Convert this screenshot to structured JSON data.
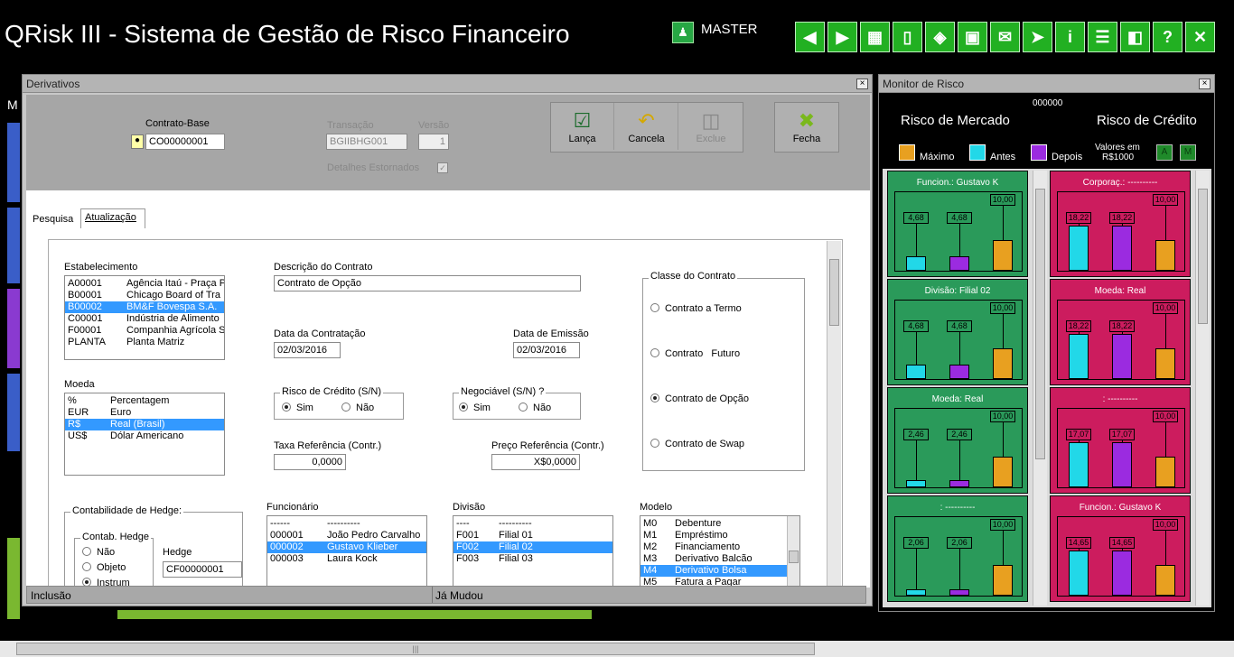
{
  "app": {
    "title": "QRisk III - Sistema de Gestão de Risco Financeiro",
    "user": "MASTER",
    "left_letter": "M"
  },
  "toolbar": {
    "icons": [
      "arrow-left-icon",
      "arrow-right-icon",
      "traffic-light-icon",
      "list-icon",
      "paint-bucket-icon",
      "monitor-icon",
      "email-icon",
      "forward-icon",
      "info-icon",
      "help-document-icon",
      "exit-door-icon",
      "question-icon",
      "close-icon"
    ]
  },
  "derivativos": {
    "title": "Derivativos",
    "close": "×",
    "contrato_base": {
      "label": "Contrato-Base",
      "value": "CO00000001"
    },
    "transacao": {
      "label": "Transação",
      "value": "BGIIBHG001"
    },
    "versao": {
      "label": "Versão",
      "value": "1"
    },
    "detalhes": {
      "label": "Detalhes Estornados"
    },
    "buttons": {
      "lanca": "Lança",
      "cancela": "Cancela",
      "exclue": "Exclue",
      "fecha": "Fecha"
    },
    "tabs": [
      "Pesquisa",
      "Atualização"
    ],
    "estabelecimento": {
      "label": "Estabelecimento",
      "rows": [
        [
          "A00001",
          "Agência Itaú - Praça P"
        ],
        [
          "B00001",
          "Chicago Board of Tra"
        ],
        [
          "B00002",
          "BM&F Bovespa S.A."
        ],
        [
          "C00001",
          "Indústria de Alimento"
        ],
        [
          "F00001",
          "Companhia Agrícola S"
        ],
        [
          "PLANTA",
          "Planta Matriz"
        ]
      ]
    },
    "moeda": {
      "label": "Moeda",
      "rows": [
        [
          "%",
          "Percentagem"
        ],
        [
          "EUR",
          "Euro"
        ],
        [
          "R$",
          "Real (Brasil)"
        ],
        [
          "US$",
          "Dólar Americano"
        ]
      ]
    },
    "descricao": {
      "label": "Descrição do Contrato",
      "value": "Contrato de Opção"
    },
    "data_contratacao": {
      "label": "Data da Contratação",
      "value": "02/03/2016"
    },
    "data_emissao": {
      "label": "Data de Emissão",
      "value": "02/03/2016"
    },
    "risco_credito": {
      "label": "Risco de Crédito (S/N)",
      "sim": "Sim",
      "nao": "Não"
    },
    "negociavel": {
      "label": "Negociável (S/N) ?",
      "sim": "Sim",
      "nao": "Não"
    },
    "taxa": {
      "label": "Taxa Referência (Contr.)",
      "value": "0,0000"
    },
    "preco": {
      "label": "Preço Referência (Contr.)",
      "value": "X$0,0000"
    },
    "classe": {
      "label": "Classe do Contrato",
      "options": [
        "Contrato a Termo",
        "Contrato   Futuro",
        "Contrato de Opção",
        "Contrato de Swap"
      ]
    },
    "hedge": {
      "group": "Contabilidade de Hedge:",
      "sub": "Contab. Hedge",
      "nao": "Não",
      "objeto": "Objeto",
      "instrum": "Instrum",
      "hedge_label": "Hedge",
      "hedge_value": "CF00000001"
    },
    "funcionario": {
      "label": "Funcionário",
      "rows": [
        [
          "------",
          "----------"
        ],
        [
          "000001",
          "João Pedro Carvalho"
        ],
        [
          "000002",
          "Gustavo Klieber"
        ],
        [
          "000003",
          "Laura Kock"
        ]
      ]
    },
    "divisao": {
      "label": "Divisão",
      "rows": [
        [
          "----",
          "----------"
        ],
        [
          "F001",
          "Filial 01"
        ],
        [
          "F002",
          "Filial 02"
        ],
        [
          "F003",
          "Filial 03"
        ]
      ]
    },
    "modelo": {
      "label": "Modelo",
      "rows": [
        [
          "M0",
          "Debenture"
        ],
        [
          "M1",
          "Empréstimo"
        ],
        [
          "M2",
          "Financiamento"
        ],
        [
          "M3",
          "Derivativo Balcão"
        ],
        [
          "M4",
          "Derivativo Bolsa"
        ],
        [
          "M5",
          "Fatura a Pagar"
        ]
      ]
    },
    "status": {
      "left": "Inclusão",
      "right": "Já Mudou"
    }
  },
  "monitor": {
    "title": "Monitor de Risco",
    "close": "×",
    "counter": "000000",
    "mercado": "Risco de Mercado",
    "credito": "Risco de Crédito",
    "legend": {
      "maximo": "Máximo",
      "antes": "Antes",
      "depois": "Depois",
      "valores": "Valores em",
      "unidade": "R$1000",
      "a": "A",
      "m": "M"
    },
    "colors": {
      "maximo": "#e8a020",
      "antes": "#22d8e8",
      "depois": "#9b2be0"
    },
    "panels": [
      {
        "title": "Funcion.: Gustavo K",
        "color": "green",
        "antes": "4,68",
        "depois": "4,68",
        "maximo": "10,00",
        "antes_v": 4.68,
        "depois_v": 4.68,
        "maximo_v": 10
      },
      {
        "title": "Corporaç.: ----------",
        "color": "red",
        "antes": "18,22",
        "depois": "18,22",
        "maximo": "10,00",
        "antes_v": 18.22,
        "depois_v": 18.22,
        "maximo_v": 10
      },
      {
        "title": "Divisão: Filial 02",
        "color": "green",
        "antes": "4,68",
        "depois": "4,68",
        "maximo": "10,00",
        "antes_v": 4.68,
        "depois_v": 4.68,
        "maximo_v": 10
      },
      {
        "title": "Moeda: Real",
        "color": "red",
        "antes": "18,22",
        "depois": "18,22",
        "maximo": "10,00",
        "antes_v": 18.22,
        "depois_v": 18.22,
        "maximo_v": 10
      },
      {
        "title": "Moeda: Real",
        "color": "green",
        "antes": "2,46",
        "depois": "2,46",
        "maximo": "10,00",
        "antes_v": 2.46,
        "depois_v": 2.46,
        "maximo_v": 10
      },
      {
        "title": ": ----------",
        "color": "red",
        "antes": "17,07",
        "depois": "17,07",
        "maximo": "10,00",
        "antes_v": 17.07,
        "depois_v": 17.07,
        "maximo_v": 10
      },
      {
        "title": ": ----------",
        "color": "green",
        "antes": "2,06",
        "depois": "2,06",
        "maximo": "10,00",
        "antes_v": 2.06,
        "depois_v": 2.06,
        "maximo_v": 10
      },
      {
        "title": "Funcion.: Gustavo K",
        "color": "red",
        "antes": "14,65",
        "depois": "14,65",
        "maximo": "10,00",
        "antes_v": 14.65,
        "depois_v": 14.65,
        "maximo_v": 10
      }
    ]
  },
  "bottom_scroll": {
    "grip": "|||"
  }
}
